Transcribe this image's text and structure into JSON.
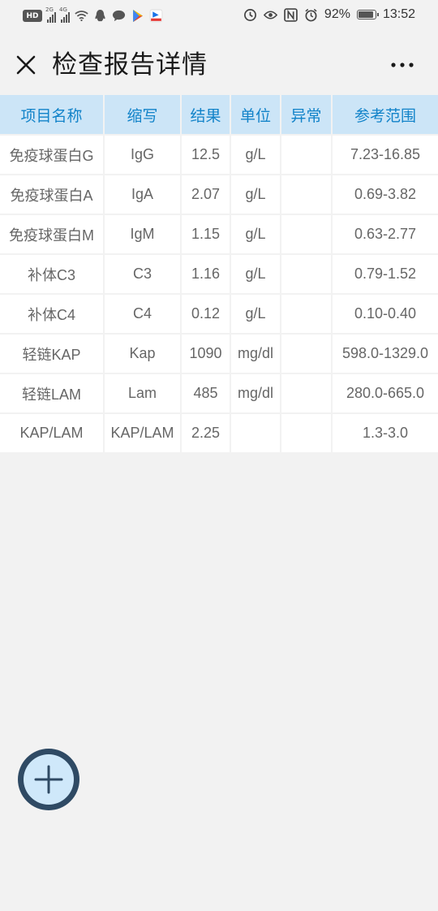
{
  "status_bar": {
    "hd_label": "HD",
    "signal_1_tag": "2G",
    "signal_2_tag": "4G",
    "battery_percent_text": "92%",
    "battery_level": 0.92,
    "time": "13:52"
  },
  "header": {
    "title": "检查报告详情",
    "more_label": "···"
  },
  "table": {
    "headers": [
      "项目名称",
      "缩写",
      "结果",
      "单位",
      "异常",
      "参考范围"
    ],
    "rows": [
      [
        "免疫球蛋白G",
        "IgG",
        "12.5",
        "g/L",
        "",
        "7.23-16.85"
      ],
      [
        "免疫球蛋白A",
        "IgA",
        "2.07",
        "g/L",
        "",
        "0.69-3.82"
      ],
      [
        "免疫球蛋白M",
        "IgM",
        "1.15",
        "g/L",
        "",
        "0.63-2.77"
      ],
      [
        "补体C3",
        "C3",
        "1.16",
        "g/L",
        "",
        "0.79-1.52"
      ],
      [
        "补体C4",
        "C4",
        "0.12",
        "g/L",
        "",
        "0.10-0.40"
      ],
      [
        "轻链KAP",
        "Kap",
        "1090",
        "mg/dl",
        "",
        "598.0-1329.0"
      ],
      [
        "轻链LAM",
        "Lam",
        "485",
        "mg/dl",
        "",
        "280.0-665.0"
      ],
      [
        "KAP/LAM",
        "KAP/LAM",
        "2.25",
        "",
        "",
        "1.3-3.0"
      ]
    ]
  },
  "colors": {
    "header_bg": "#cce5f7",
    "header_text": "#1283c9",
    "fab_ring": "#2f4a64",
    "fab_fill": "#cfe8fa"
  },
  "icons": {
    "close": "close-icon",
    "more": "more-icon",
    "add": "plus-icon"
  }
}
